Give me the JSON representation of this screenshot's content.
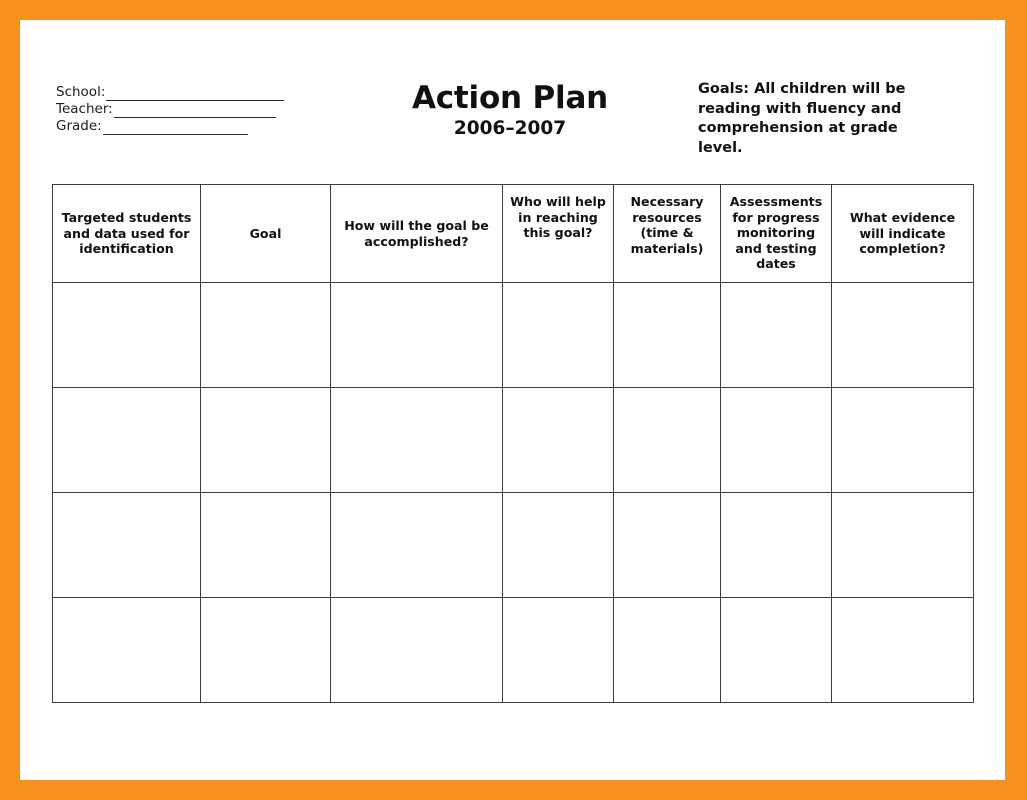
{
  "document": {
    "title": "Action Plan",
    "subtitle": "2006–2007"
  },
  "fields": [
    {
      "label": "School:",
      "value": ""
    },
    {
      "label": "Teacher:",
      "value": ""
    },
    {
      "label": "Grade:",
      "value": ""
    }
  ],
  "goals": {
    "text": "Goals: All children will be reading with fluency and comprehension at grade level."
  },
  "table": {
    "headers": [
      "Targeted students and data used for identification",
      "Goal",
      "How will the goal be accomplished?",
      "Who will help in reaching this goal?",
      "Necessary resources (time & materials)",
      "Assessments for progress monitoring and testing dates",
      "What evidence will indicate completion?"
    ],
    "rows": [
      [
        "",
        "",
        "",
        "",
        "",
        "",
        ""
      ],
      [
        "",
        "",
        "",
        "",
        "",
        "",
        ""
      ],
      [
        "",
        "",
        "",
        "",
        "",
        "",
        ""
      ],
      [
        "",
        "",
        "",
        "",
        "",
        "",
        ""
      ]
    ]
  },
  "colors": {
    "frame": "#f7921e",
    "text": "#111111",
    "grid": "#3d3d3d",
    "paper": "#ffffff"
  }
}
